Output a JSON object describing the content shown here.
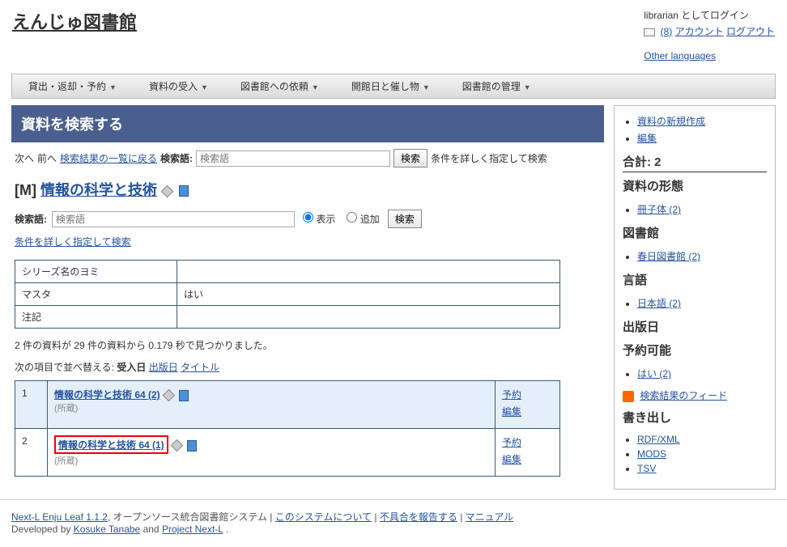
{
  "site": {
    "title": "えんじゅ図書館"
  },
  "login": {
    "status": "librarian としてログイン",
    "notif_count": "(8)",
    "account": "アカウント",
    "logout": "ログアウト",
    "other_lang": "Other languages"
  },
  "nav": [
    "貸出・返却・予約",
    "資料の受入",
    "図書館への依頼",
    "開館日と催し物",
    "図書館の管理"
  ],
  "main": {
    "panel_header": "資料を検索する",
    "search1": {
      "next": "次へ",
      "prev": "前へ",
      "back": "検索結果の一覧に戻る",
      "label": "検索語:",
      "placeholder": "検索語",
      "button": "検索",
      "advanced_tail": "条件を詳しく指定して検索"
    },
    "record": {
      "prefix": "[M]",
      "title": "情報の科学と技術"
    },
    "search2": {
      "label": "検索語:",
      "placeholder": "検索語",
      "opt_display": "表示",
      "opt_add": "追加",
      "button": "検索"
    },
    "advanced_link": "条件を詳しく指定して検索",
    "meta": [
      {
        "label": "シリーズ名のヨミ",
        "value": ""
      },
      {
        "label": "マスタ",
        "value": "はい"
      },
      {
        "label": "注記",
        "value": ""
      }
    ],
    "hits": "2 件の資料が 29 件の資料から 0.179 秒で見つかりました。",
    "sort": {
      "label": "次の項目で並べ替える:",
      "active": "受入日",
      "opts": [
        "出版日",
        "タイトル"
      ]
    },
    "results": [
      {
        "n": "1",
        "title": "情報の科学と技術 64 (2)",
        "holding": "(所蔵)",
        "highlighted": false
      },
      {
        "n": "2",
        "title": "情報の科学と技術 64 (1)",
        "holding": "(所蔵)",
        "highlighted": true
      }
    ],
    "actions": {
      "reserve": "予約",
      "edit": "編集"
    }
  },
  "sidebar": {
    "top_links": [
      "資料の新規作成",
      "編集"
    ],
    "total": {
      "label": "合計:",
      "value": "2"
    },
    "form": {
      "heading": "資料の形態",
      "items": [
        "冊子体 (2)"
      ]
    },
    "library": {
      "heading": "図書館",
      "items": [
        "春日図書館 (2)"
      ]
    },
    "language": {
      "heading": "言語",
      "items": [
        "日本語 (2)"
      ]
    },
    "pubdate": {
      "heading": "出版日"
    },
    "reservable": {
      "heading": "予約可能",
      "items": [
        "はい (2)"
      ]
    },
    "feed": "検索結果のフィード",
    "export": {
      "heading": "書き出し",
      "items": [
        "RDF/XML",
        "MODS",
        "TSV"
      ]
    }
  },
  "footer": {
    "product": "Next-L Enju Leaf 1.1.2",
    "suffix": ", オープンソース統合図書館システム |",
    "about": "このシステムについて",
    "sep": " | ",
    "bug": "不具合を報告する",
    "manual": "マニュアル",
    "dev_prefix": "Developed by ",
    "dev1": "Kosuke Tanabe",
    "dev_and": " and ",
    "dev2": "Project Next-L",
    "dev_end": "."
  }
}
